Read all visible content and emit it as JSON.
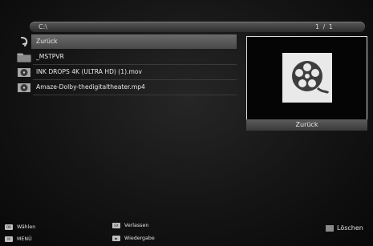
{
  "path_bar": {
    "path": "C:\\",
    "page": "1 / 1"
  },
  "files": [
    {
      "name": "Zurück",
      "icon": "back-arrow-icon",
      "selected": true
    },
    {
      "name": "_MSTPVR",
      "icon": "folder-icon",
      "selected": false
    },
    {
      "name": "INK DROPS 4K (ULTRA HD) (1).mov",
      "icon": "film-reel-icon",
      "selected": false
    },
    {
      "name": "Amaze-Dolby-thedigitaltheater.mp4",
      "icon": "film-reel-icon",
      "selected": false
    }
  ],
  "preview": {
    "icon": "film-reel-icon",
    "label": "Zurück"
  },
  "footer": {
    "select": "Wählen",
    "menu": "MENÜ",
    "exit": "Verlassen",
    "play": "Wiedergabe",
    "delete": "Löschen"
  }
}
